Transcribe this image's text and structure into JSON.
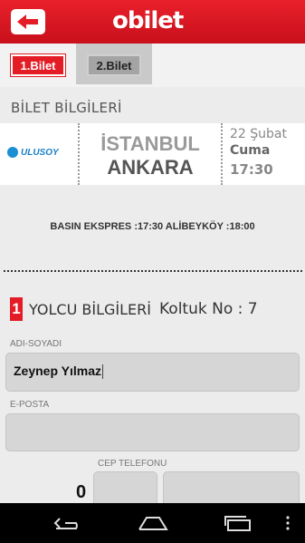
{
  "header": {
    "logo": "obilet"
  },
  "tabs": [
    {
      "label": "1.Bilet"
    },
    {
      "label": "2.Bilet"
    }
  ],
  "section_title": "BİLET BİLGİLERİ",
  "trip": {
    "operator": "ULUSOY",
    "from": "İSTANBUL",
    "to": "ANKARA",
    "date": "22 Şubat",
    "day": "Cuma",
    "time": "17:30"
  },
  "route": "BASIN EKSPRES :17:30 ALİBEYKÖY :18:00",
  "passenger": {
    "number": "1",
    "title": "YOLCU BİLGİLERİ",
    "seat": "Koltuk No : 7",
    "name_label": "ADI-SOYADI",
    "name_value": "Zeynep Yılmaz",
    "email_label": "E-POSTA",
    "email_value": "",
    "phone_label": "CEP TELEFONU",
    "phone_prefix": "0"
  },
  "colors": {
    "brand": "#e31c25",
    "field": "#d6d6d6"
  },
  "icons": {
    "back": "back-arrow-icon",
    "nav_back": "nav-back-icon",
    "nav_home": "nav-home-icon",
    "nav_recent": "nav-recent-icon",
    "menu": "overflow-menu-icon"
  }
}
